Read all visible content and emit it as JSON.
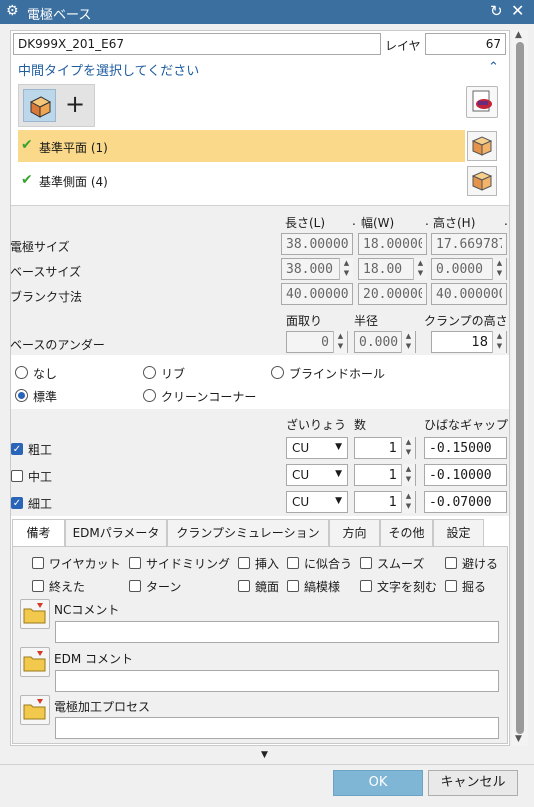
{
  "window": {
    "title": "電極ベース",
    "gear_icon": "gear-icon",
    "reset_icon": "reset-icon",
    "close_icon": "close-icon"
  },
  "top": {
    "name_value": "DK999X_201_E67",
    "layer_label": "レイヤ",
    "layer_value": "67"
  },
  "section": {
    "title": "中間タイプを選択してください",
    "items": [
      {
        "label": "基準平面 (1)",
        "selected": true
      },
      {
        "label": "基準側面 (4)",
        "selected": false
      }
    ],
    "accent": "#fbd98b"
  },
  "dims": {
    "col_headers": [
      "長さ(L)",
      "幅(W)",
      "高さ(H)"
    ],
    "rows": [
      {
        "label": "電極サイズ",
        "values": [
          "38.00000",
          "18.00000",
          "17.669787"
        ]
      },
      {
        "label": "ベースサイズ",
        "values": [
          "38.000",
          "18.00",
          "0.0000"
        ]
      },
      {
        "label": "ブランク寸法",
        "values": [
          "40.00000",
          "20.00000",
          "40.000000"
        ]
      }
    ]
  },
  "under": {
    "headers": [
      "面取り",
      "半径",
      "クランプの高さ"
    ],
    "label": "ベースのアンダー",
    "chamfer": "0",
    "radius": "0.000",
    "clamp": "18"
  },
  "shape": {
    "options": [
      "なし",
      "リブ",
      "ブラインドホール",
      "標準",
      "クリーンコーナー"
    ],
    "selected": "標準"
  },
  "machining": {
    "headers": [
      "ざいりょう",
      "数",
      "ひばなギャップ"
    ],
    "rows": [
      {
        "label": "粗工",
        "checked": true,
        "material": "CU",
        "count": "1",
        "gap": "-0.15000"
      },
      {
        "label": "中工",
        "checked": false,
        "material": "CU",
        "count": "1",
        "gap": "-0.10000"
      },
      {
        "label": "細工",
        "checked": true,
        "material": "CU",
        "count": "1",
        "gap": "-0.07000"
      }
    ]
  },
  "tabs": [
    "備考",
    "EDMパラメータ",
    "クランプシミュレーション",
    "方向",
    "その他",
    "設定"
  ],
  "remarks": {
    "checks": [
      "ワイヤカット",
      "サイドミリング",
      "挿入",
      "に似合う",
      "スムーズ",
      "避ける",
      "終えた",
      "ターン",
      "鏡面",
      "縞模様",
      "文字を刻む",
      "掘る"
    ],
    "fields": [
      {
        "label": "NCコメント",
        "value": ""
      },
      {
        "label": "EDM コメント",
        "value": ""
      },
      {
        "label": "電極加工プロセス",
        "value": ""
      }
    ]
  },
  "footer": {
    "ok": "OK",
    "cancel": "キャンセル"
  },
  "colors": {
    "titlebar": "#3b6fa0",
    "ok_button": "#7fb6d6",
    "check": "#2a64b8"
  }
}
